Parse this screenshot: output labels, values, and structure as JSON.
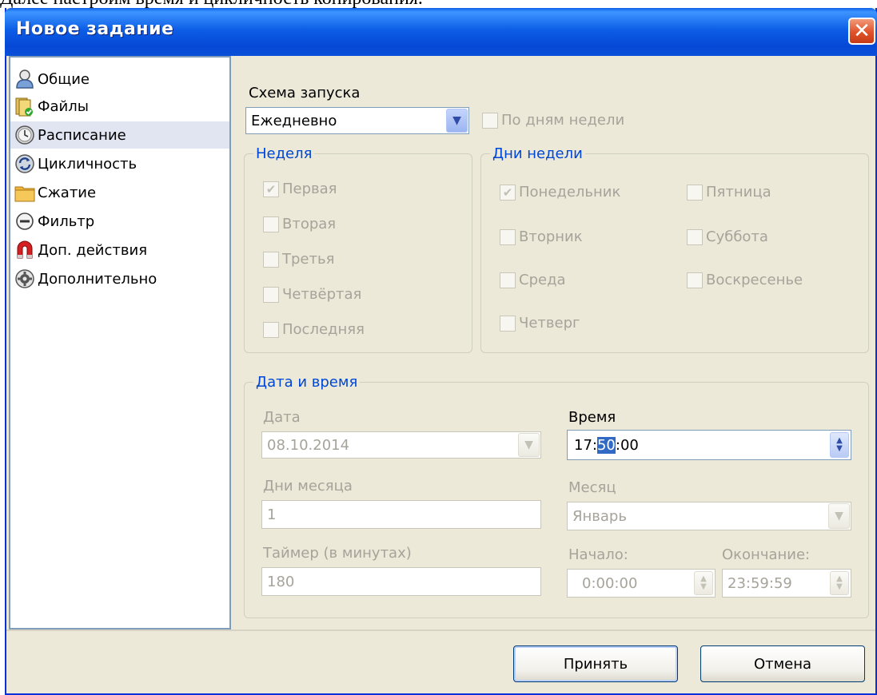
{
  "caption": "Далее настроим время и цикличность копирования.",
  "window": {
    "title": "Новое задание"
  },
  "sidebar": {
    "items": [
      {
        "label": "Общие",
        "icon": "user-icon"
      },
      {
        "label": "Файлы",
        "icon": "files-icon"
      },
      {
        "label": "Расписание",
        "icon": "clock-icon",
        "active": true
      },
      {
        "label": "Цикличность",
        "icon": "cycle-icon"
      },
      {
        "label": "Сжатие",
        "icon": "folder-icon"
      },
      {
        "label": "Фильтр",
        "icon": "minus-icon"
      },
      {
        "label": "Доп. действия",
        "icon": "magnet-icon"
      },
      {
        "label": "Дополнительно",
        "icon": "gear-icon"
      }
    ]
  },
  "schedule": {
    "scheme_label": "Схема запуска",
    "scheme_value": "Ежедневно",
    "by_weekdays_label": "По дням недели"
  },
  "week": {
    "title": "Неделя",
    "items": [
      {
        "label": "Первая",
        "checked": true
      },
      {
        "label": "Вторая",
        "checked": false
      },
      {
        "label": "Третья",
        "checked": false
      },
      {
        "label": "Четвёртая",
        "checked": false
      },
      {
        "label": "Последняя",
        "checked": false
      }
    ]
  },
  "weekdays": {
    "title": "Дни недели",
    "items": [
      {
        "label": "Понедельник",
        "checked": true
      },
      {
        "label": "Вторник",
        "checked": false
      },
      {
        "label": "Среда",
        "checked": false
      },
      {
        "label": "Четверг",
        "checked": false
      },
      {
        "label": "Пятница",
        "checked": false
      },
      {
        "label": "Суббота",
        "checked": false
      },
      {
        "label": "Воскресенье",
        "checked": false
      }
    ]
  },
  "datetime": {
    "title": "Дата и время",
    "date_label": "Дата",
    "date_value": "08.10.2014",
    "time_label": "Время",
    "time_hours": "17:",
    "time_minutes": "50",
    "time_rest": ":00",
    "month_days_label": "Дни месяца",
    "month_days_value": "1",
    "month_label": "Месяц",
    "month_value": "Январь",
    "timer_label": "Таймер (в минутах)",
    "timer_value": "180",
    "start_label": "Начало:",
    "start_value": "0:00:00",
    "end_label": "Окончание:",
    "end_value": "23:59:59"
  },
  "buttons": {
    "accept": "Принять",
    "cancel": "Отмена"
  },
  "colors": {
    "titlebar": "#0a50d8",
    "dialog_bg": "#ece9d8",
    "group_title": "#0046d5",
    "disabled_text": "#a6a49a",
    "selection": "#316ac5"
  }
}
